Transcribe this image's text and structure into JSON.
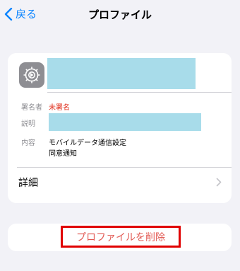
{
  "nav": {
    "back_label": "戻る",
    "title": "プロファイル"
  },
  "profile": {
    "signer_label": "署名者",
    "signer_value": "未署名",
    "desc_label": "説明",
    "content_label": "内容",
    "content_line1": "モバイルデータ通信設定",
    "content_line2": "同意通知"
  },
  "details_label": "詳細",
  "remove_button": "プロファイルを削除",
  "icons": {
    "back": "chevron-left-icon",
    "settings": "gear-icon",
    "details": "chevron-right-icon"
  },
  "colors": {
    "accent": "#0a84ff",
    "destructive": "#e25b55",
    "unsigned": "#e0301e",
    "highlight": "#e00000"
  }
}
